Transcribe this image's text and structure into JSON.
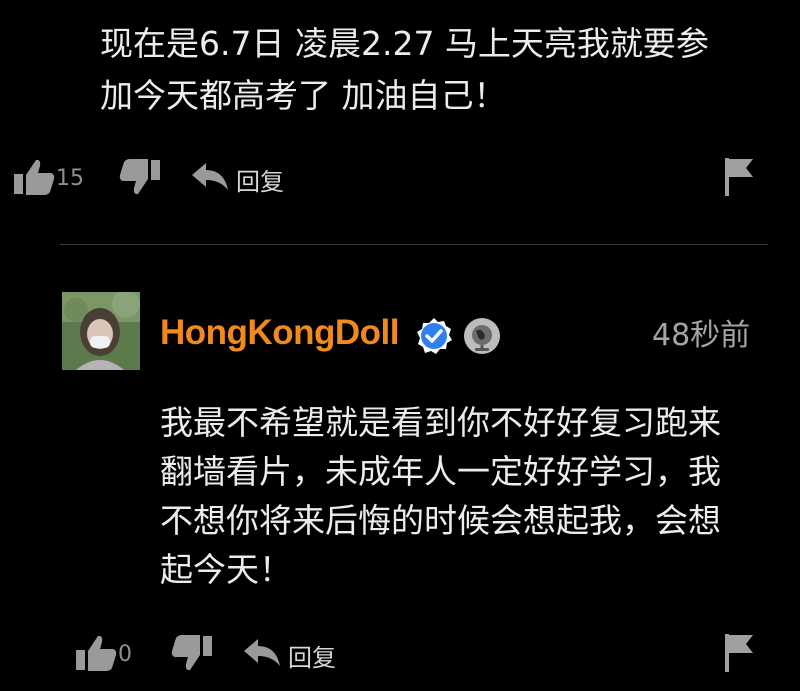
{
  "top_comment": {
    "text": "现在是6.7日 凌晨2.27 马上天亮我就要参\n加今天都高考了 加油自己！",
    "like_count": "15",
    "reply_label": "回复"
  },
  "reply_comment": {
    "username": "HongKongDoll",
    "timestamp": "48秒前",
    "text": "我最不希望就是看到你不好好复习跑来\n翻墙看片，未成年人一定好好学习，我\n不想你将来后悔的时候会想起我，会想\n起今天！",
    "like_count": "0",
    "reply_label": "回复"
  },
  "colors": {
    "background": "#000000",
    "username": "#f08a1c",
    "verified_badge": "#2f7ff0",
    "icon_gray": "#9a9a9a"
  },
  "icons": [
    "thumbs-up-icon",
    "thumbs-down-icon",
    "reply-arrow-icon",
    "flag-icon",
    "verified-badge-icon",
    "globe-icon"
  ]
}
